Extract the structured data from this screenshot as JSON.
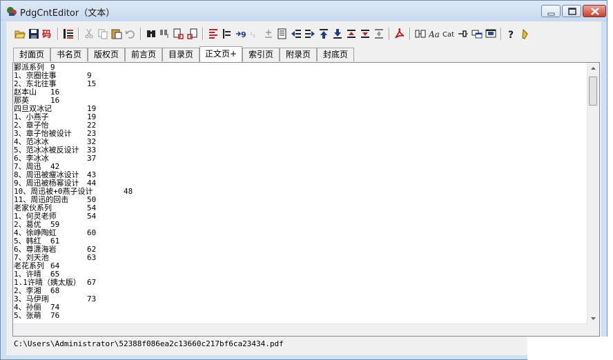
{
  "window": {
    "title": "PdgCntEditor（文本）"
  },
  "title_buttons": {
    "minimize": "minimize",
    "maximize": "maximize",
    "close": "close"
  },
  "toolbar": [
    "open-folder-icon",
    "save-icon",
    "codepage-icon",
    "outline-icon",
    "cut-icon",
    "copy-icon",
    "paste-icon",
    "undo-icon",
    "find-icon",
    "replace-icon",
    "find-page-icon",
    "replace-page-icon",
    "align-left-icon",
    "indent-icon",
    "page-number-icon",
    "grey-number-icon",
    "plusminus-icon",
    "page-icon",
    "outdent-icon",
    "indent-more-icon",
    "move-top-icon",
    "move-bottom-icon",
    "move-up-icon",
    "move-down-icon",
    "expand-icon",
    "acrobat-icon",
    "columns-icon",
    "font-icon",
    "cat-icon",
    "pin-icon",
    "window-icon",
    "screen-icon",
    "help-icon",
    "pencil-icon"
  ],
  "tabs": [
    {
      "label": "封面页"
    },
    {
      "label": "书名页"
    },
    {
      "label": "版权页"
    },
    {
      "label": "前言页"
    },
    {
      "label": "目录页"
    },
    {
      "label": "正文页+",
      "active": true
    },
    {
      "label": "索引页"
    },
    {
      "label": "附录页"
    },
    {
      "label": "封底页"
    }
  ],
  "content_lines": [
    "鄞派系列\t9",
    "1、京圈往事\t9",
    "2、东北往事\t15",
    "赵本山\t16",
    "那英\t16",
    "四旦双冰记\t19",
    "1、小燕子\t19",
    "2、章子怡\t22",
    "3、章子怡被设计\t23",
    "4、范冰冰\t32",
    "5、范冰冰被反设计\t33",
    "6、李冰冰\t37",
    "7、周迅\t42",
    "8、周迅被瘦冰设计\t43",
    "9、周迅被杨幂设计\t44",
    "10、周迅被+0燕子设计\t48",
    "11、周迅的回击\t50",
    "老家伙系列\t54",
    "1、何灵老师\t54",
    "2、葛优\t59",
    "4、徐峥陶虹\t60",
    "5、韩红\t61",
    "6、尊潇海岩\t62",
    "7、刘天池\t63",
    "老花系列\t64",
    "1、许晴\t65",
    "1.1许晴（姨太版）\t67",
    "2、李湘\t68",
    "3、马伊琍\t73",
    "4、孙俪\t74",
    "5、张萌\t76"
  ],
  "status": {
    "path": "C:\\Users\\Administrator\\52388f086ea2c13660c217bf6ca23434.pdf"
  }
}
